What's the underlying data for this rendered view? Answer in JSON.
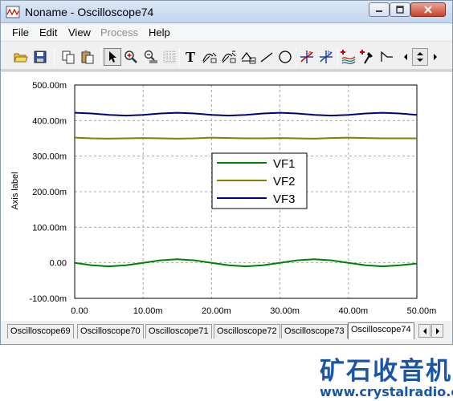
{
  "window": {
    "title": "Noname - Oscilloscope74",
    "controls": {
      "minimize": "─",
      "maximize": "□",
      "close": "✕"
    }
  },
  "menu": {
    "items": [
      {
        "label": "File",
        "enabled": true
      },
      {
        "label": "Edit",
        "enabled": true
      },
      {
        "label": "View",
        "enabled": true
      },
      {
        "label": "Process",
        "enabled": false
      },
      {
        "label": "Help",
        "enabled": true
      }
    ]
  },
  "toolbar": {
    "text_tool_glyph": "T"
  },
  "chart_data": {
    "type": "line",
    "ylabel": "Axis label",
    "xlabel": "",
    "xlim": [
      0,
      0.05
    ],
    "ylim": [
      -0.1,
      0.5
    ],
    "x_ticks": [
      "0.00",
      "10.00m",
      "20.00m",
      "30.00m",
      "40.00m",
      "50.00m"
    ],
    "y_ticks": [
      "500.00m",
      "400.00m",
      "300.00m",
      "200.00m",
      "100.00m",
      "0.00",
      "-100.00m"
    ],
    "grid": true,
    "legend_position": "center",
    "series": [
      {
        "name": "VF1",
        "color": "#008000",
        "x": [
          0,
          0.0025,
          0.005,
          0.0075,
          0.01,
          0.0125,
          0.015,
          0.0175,
          0.02,
          0.0225,
          0.025,
          0.0275,
          0.03,
          0.0325,
          0.035,
          0.0375,
          0.04,
          0.0425,
          0.045,
          0.0475,
          0.05
        ],
        "y": [
          0.0,
          -0.007,
          -0.01,
          -0.007,
          0.0,
          0.007,
          0.01,
          0.007,
          0.0,
          -0.007,
          -0.01,
          -0.007,
          0.0,
          0.007,
          0.01,
          0.007,
          0.0,
          -0.007,
          -0.01,
          -0.007,
          -0.002
        ]
      },
      {
        "name": "VF2",
        "color": "#808000",
        "x": [
          0,
          0.0025,
          0.005,
          0.0075,
          0.01,
          0.0125,
          0.015,
          0.0175,
          0.02,
          0.0225,
          0.025,
          0.0275,
          0.03,
          0.0325,
          0.035,
          0.0375,
          0.04,
          0.0425,
          0.045,
          0.0475,
          0.05
        ],
        "y": [
          0.352,
          0.35,
          0.349,
          0.35,
          0.351,
          0.35,
          0.349,
          0.35,
          0.352,
          0.351,
          0.35,
          0.35,
          0.351,
          0.35,
          0.349,
          0.351,
          0.352,
          0.351,
          0.35,
          0.35,
          0.35
        ]
      },
      {
        "name": "VF3",
        "color": "#000080",
        "x": [
          0,
          0.0025,
          0.005,
          0.0075,
          0.01,
          0.0125,
          0.015,
          0.0175,
          0.02,
          0.0225,
          0.025,
          0.0275,
          0.03,
          0.0325,
          0.035,
          0.0375,
          0.04,
          0.0425,
          0.045,
          0.0475,
          0.05
        ],
        "y": [
          0.422,
          0.42,
          0.416,
          0.414,
          0.416,
          0.42,
          0.422,
          0.42,
          0.416,
          0.414,
          0.416,
          0.42,
          0.422,
          0.42,
          0.416,
          0.414,
          0.416,
          0.42,
          0.422,
          0.42,
          0.416
        ]
      }
    ]
  },
  "tabs": {
    "items": [
      {
        "label": "Oscilloscope69",
        "active": false
      },
      {
        "label": "Oscilloscope70",
        "active": false
      },
      {
        "label": "Oscilloscope71",
        "active": false
      },
      {
        "label": "Oscilloscope72",
        "active": false
      },
      {
        "label": "Oscilloscope73",
        "active": false
      },
      {
        "label": "Oscilloscope74",
        "active": true
      }
    ]
  },
  "watermark": {
    "brand_cn": "矿石收音机",
    "url": "www.crystalradio.cn",
    "color": "#1a56a8"
  }
}
